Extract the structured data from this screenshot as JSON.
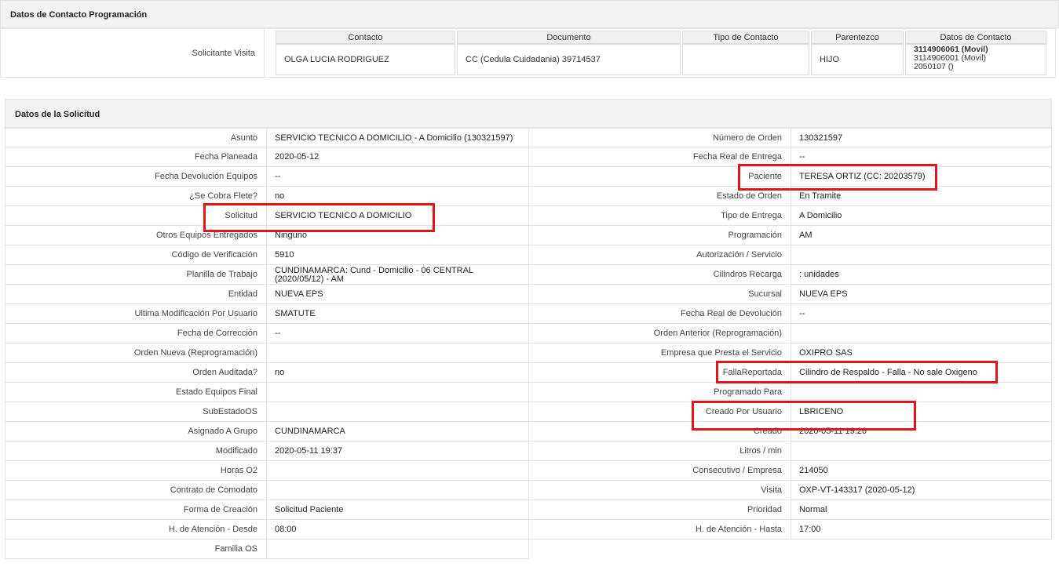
{
  "contact_section": {
    "title": "Datos de Contacto Programación",
    "row_label": "Solicitante Visita",
    "headers": [
      "Contacto",
      "Documento",
      "Tipo de Contacto",
      "Parentezco",
      "Datos de Contacto"
    ],
    "contact": "OLGA LUCIA RODRIGUEZ",
    "document": "CC (Cedula Cuidadania) 39714537",
    "contact_type": "",
    "relationship": "HIJO",
    "phones": [
      "3114906061 (Movil)",
      "3114906001 (Movil)",
      "2050107 ()"
    ]
  },
  "request_section": {
    "title": "Datos de la Solicitud",
    "rows": [
      {
        "l1": "Asunto",
        "v1": "SERVICIO TECNICO A DOMICILIO - A Domicilio (130321597)",
        "l2": "Número de Orden",
        "v2": "130321597"
      },
      {
        "l1": "Fecha Planeada",
        "v1": " 2020-05-12",
        "l2": "Fecha Real de Entrega",
        "v2": " --"
      },
      {
        "l1": "Fecha Devolución Equipos",
        "v1": " --",
        "l2": "Paciente",
        "v2": "TERESA ORTIZ (CC: 20203579)"
      },
      {
        "l1": "¿Se Cobra Flete?",
        "v1": "no",
        "l2": "Estado de Orden",
        "v2": "En Tramite"
      },
      {
        "l1": "Solicitud",
        "v1": "SERVICIO TECNICO A DOMICILIO",
        "l2": "Tipo de Entrega",
        "v2": "A Domicilio"
      },
      {
        "l1": "Otros Equipos Entregados",
        "v1": "Ninguno",
        "l2": "Programación",
        "v2": "AM"
      },
      {
        "l1": "Código de Verificación",
        "v1": "5910",
        "l2": "Autorización / Servicio",
        "v2": ""
      },
      {
        "l1": "Planilla de Trabajo",
        "v1": "CUNDINAMARCA: Cund - Domicilio - 06 CENTRAL",
        "v1b": "(2020/05/12) - AM",
        "l2": "Cilindros Recarga",
        "v2": ": unidades"
      },
      {
        "l1": "Entidad",
        "v1": "NUEVA EPS",
        "l2": "Sucursal",
        "v2": "NUEVA EPS"
      },
      {
        "l1": "Ultima Modificación Por Usuario",
        "v1": "SMATUTE",
        "l2": "Fecha Real de Devolución",
        "v2": " --"
      },
      {
        "l1": "Fecha de Corrección",
        "v1": " --",
        "l2": "Orden Anterior (Reprogramación)",
        "v2": ""
      },
      {
        "l1": "Orden Nueva (Reprogramación)",
        "v1": "",
        "l2": "Empresa que Presta el Servicio",
        "v2": "OXIPRO SAS"
      },
      {
        "l1": "Orden Auditada?",
        "v1": "no",
        "l2": "FallaReportada",
        "v2": "Cilindro de Respaldo - Falla - No sale Oxigeno"
      },
      {
        "l1": "Estado Equipos Final",
        "v1": "",
        "l2": "Programado Para",
        "v2": ""
      },
      {
        "l1": "SubEstadoOS",
        "v1": "",
        "l2": "Creado Por Usuario",
        "v2": "LBRICENO"
      },
      {
        "l1": "Asignado A Grupo",
        "v1": "CUNDINAMARCA",
        "l2": "Creado",
        "v2": "2020-05-11 19:26"
      },
      {
        "l1": "Modificado",
        "v1": "2020-05-11 19:37",
        "l2": "Litros / min",
        "v2": ""
      },
      {
        "l1": "Horas O2",
        "v1": "",
        "l2": "Consecutivo / Empresa",
        "v2": "214050"
      },
      {
        "l1": "Contrato de Comodato",
        "v1": "",
        "l2": "Visita",
        "v2": "OXP-VT-143317 (2020-05-12)"
      },
      {
        "l1": "Forma de Creación",
        "v1": "Solicitud Paciente",
        "l2": "Prioridad",
        "v2": "Normal"
      },
      {
        "l1": "H. de Atención - Desde",
        "v1": "08:00",
        "l2": "H. de Atención - Hasta",
        "v2": "17:00"
      },
      {
        "l1": "Familia OS",
        "v1": ""
      }
    ]
  },
  "colors": {
    "highlight": "#e0161e",
    "header_bg": "#f2f2f2",
    "border": "#e2e2e2"
  }
}
